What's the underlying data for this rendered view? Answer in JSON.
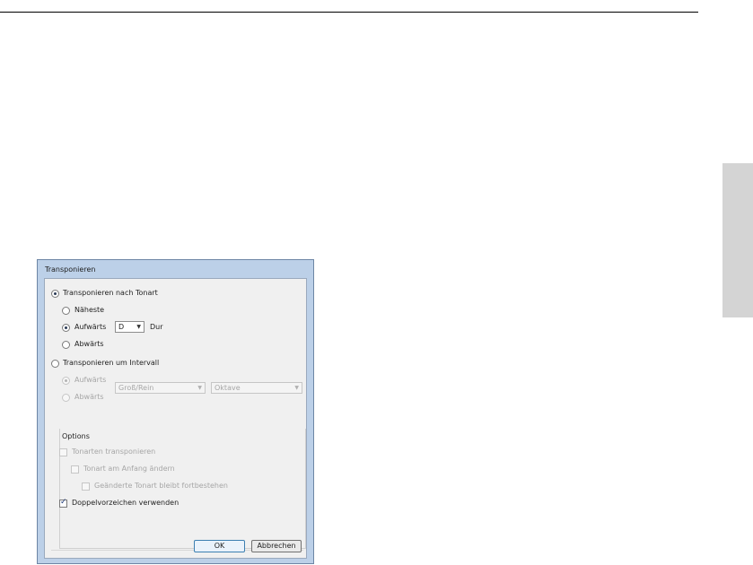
{
  "dialog": {
    "title": "Transponieren",
    "by_key": {
      "label": "Transponieren nach Tonart",
      "selected": true,
      "nearest_label": "Näheste",
      "up_label": "Aufwärts",
      "up_selected": true,
      "key_value": "D",
      "mode_label": "Dur",
      "down_label": "Abwärts"
    },
    "by_interval": {
      "label": "Transponieren um Intervall",
      "selected": false,
      "up_label": "Aufwärts",
      "down_label": "Abwärts",
      "quality_value": "Groß/Rein",
      "interval_value": "Oktave"
    },
    "options": {
      "title": "Options",
      "transpose_keys_label": "Tonarten transponieren",
      "change_key_at_start_label": "Tonart am Anfang ändern",
      "changed_key_persists_label": "Geänderte Tonart bleibt fortbestehen",
      "use_double_accidentals_label": "Doppelvorzeichen verwenden",
      "use_double_accidentals_checked": true
    },
    "buttons": {
      "ok": "OK",
      "cancel": "Abbrechen"
    }
  }
}
